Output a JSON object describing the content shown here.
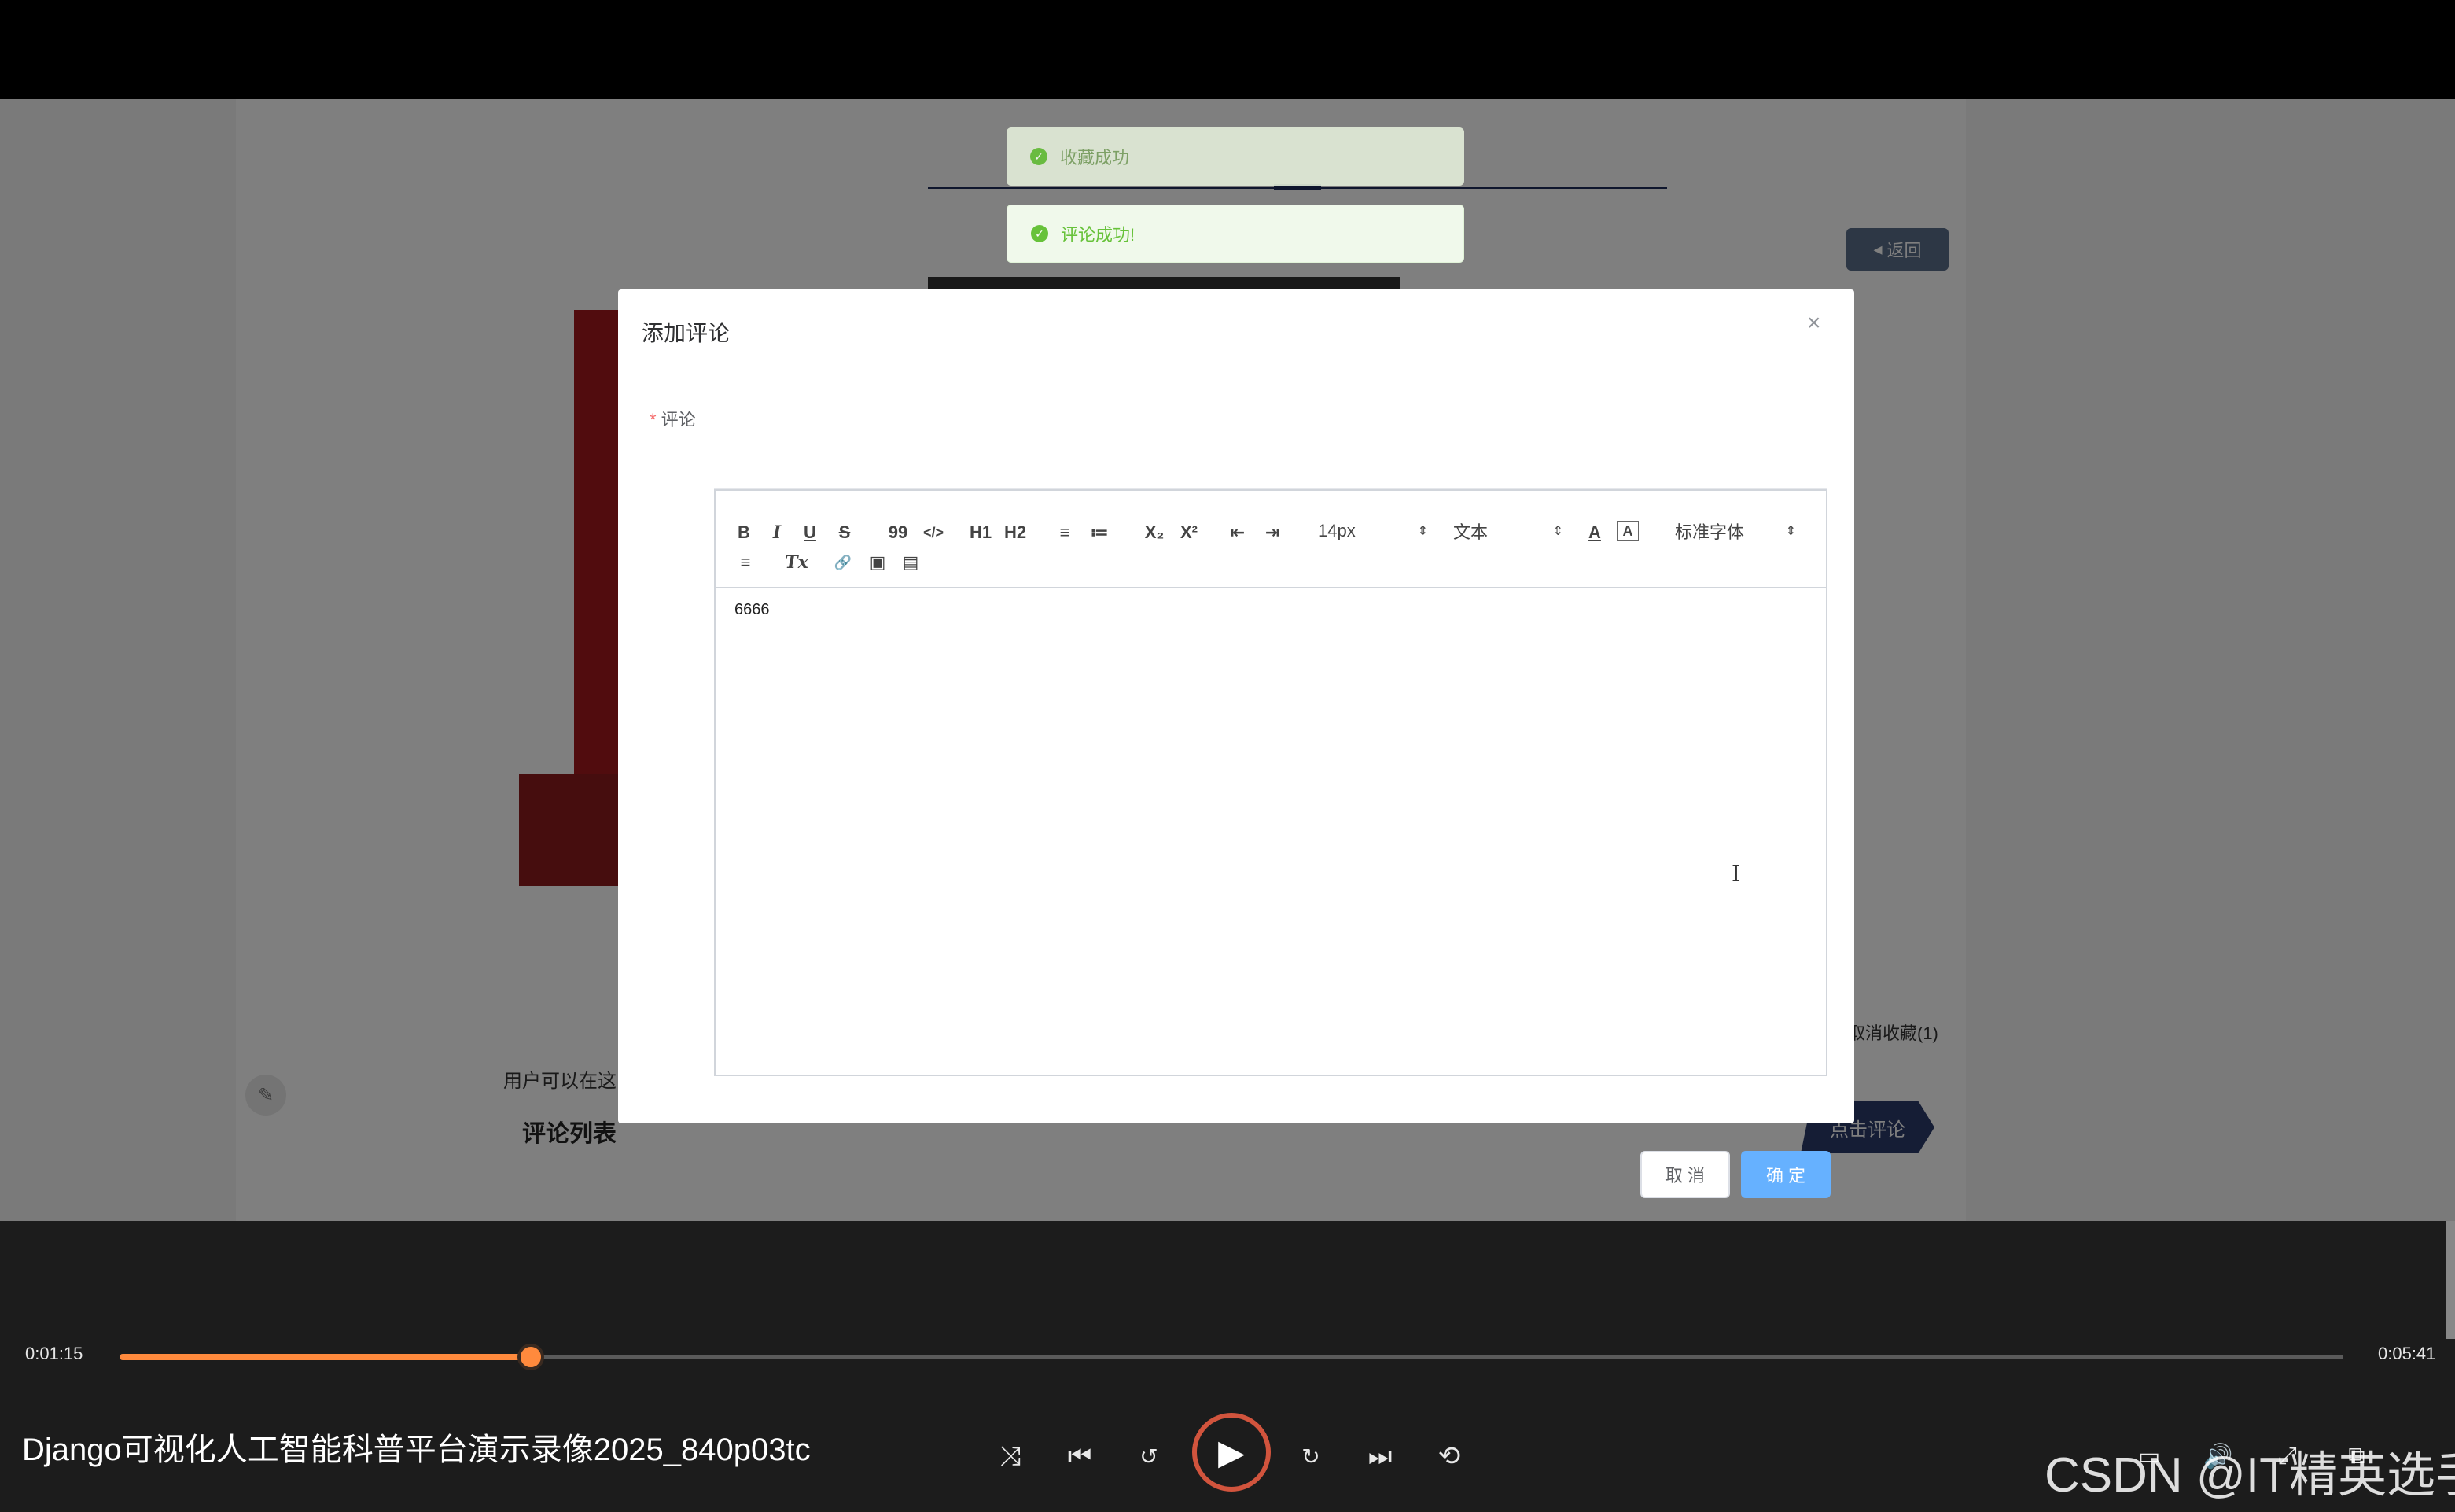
{
  "toasts": {
    "favorite": "收藏成功",
    "comment": "评论成功!"
  },
  "background_page": {
    "back_button": "返回",
    "favorite_status": "取消收藏(1)",
    "user_hint": "用户可以在这",
    "comment_list_title": "评论列表",
    "click_comment_button": "点击评论"
  },
  "dialog": {
    "title": "添加评论",
    "close": "×",
    "field_label": "评论",
    "required_mark": "*",
    "toolbar": {
      "bold": "B",
      "italic": "I",
      "underline": "U",
      "strike": "S",
      "blockquote": "99",
      "code": "</>",
      "h1": "H1",
      "h2": "H2",
      "ordered_list": "≡",
      "bullet_list": "≔",
      "subscript": "X₂",
      "superscript": "X²",
      "outdent": "⇤",
      "indent": "⇥",
      "font_size": "14px",
      "text_type": "文本",
      "font_color": "A",
      "bg_color": "A",
      "font_family": "标准字体",
      "align": "≡",
      "clear_format": "Tx",
      "link": "🔗",
      "image": "▣",
      "video": "▤"
    },
    "content": "6666",
    "cancel": "取 消",
    "confirm": "确 定"
  },
  "player": {
    "current_time": "0:01:15",
    "total_time": "0:05:41",
    "progress": 0.1848,
    "media_title": "Django可视化人工智能科普平台演示录像2025_840p03tc",
    "watermark": "CSDN @IT精英选手"
  },
  "colors": {
    "accent_orange": "#ff8a3d",
    "success_green": "#67c23a",
    "primary_blue": "#66b1ff",
    "nav_navy": "#2a3a6b"
  }
}
